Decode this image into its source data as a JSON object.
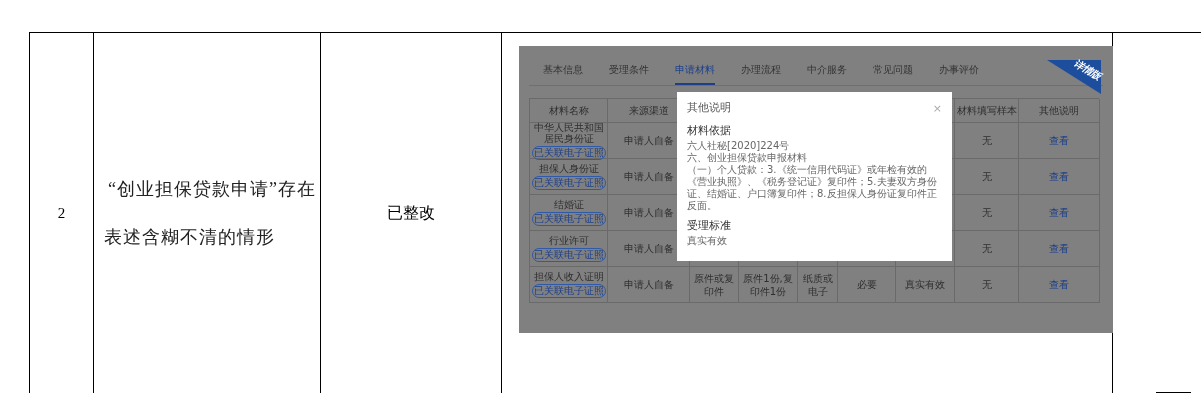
{
  "row": {
    "number": "2",
    "issue": "“创业担保贷款申请”存在表述含糊不清的情形",
    "status": "已整改"
  },
  "screenshot": {
    "tabs": [
      {
        "label": "基本信息",
        "selected": false
      },
      {
        "label": "受理条件",
        "selected": false
      },
      {
        "label": "申请材料",
        "selected": true
      },
      {
        "label": "办理流程",
        "selected": false
      },
      {
        "label": "中介服务",
        "selected": false
      },
      {
        "label": "常见问题",
        "selected": false
      },
      {
        "label": "办事评价",
        "selected": false
      }
    ],
    "ribbon": "详情版",
    "columns_left": [
      "材料名称",
      "来源渠道"
    ],
    "columns_right": [
      "材料填写样本",
      "其他说明"
    ],
    "rows": [
      {
        "name": "中华人民共和国居民身份证",
        "tag": "已关联电子证照",
        "source": "申请人自备",
        "sample": "无",
        "link": "查看"
      },
      {
        "name": "担保人身份证",
        "tag": "已关联电子证照",
        "source": "申请人自备",
        "sample": "无",
        "link": "查看"
      },
      {
        "name": "结婚证",
        "tag": "已关联电子证照",
        "source": "申请人自备",
        "sample": "无",
        "link": "查看"
      },
      {
        "name": "行业许可",
        "tag": "已关联电子证照",
        "source": "申请人自备",
        "sample": "无",
        "link": "查看"
      },
      {
        "name": "担保人收入证明",
        "tag": "已关联电子证照",
        "source": "申请人自备",
        "cells": [
          "原件或复印件",
          "原件1份,复印件1份",
          "纸质或电子",
          "必要",
          "真实有效"
        ],
        "sample": "无",
        "link": "查看"
      }
    ],
    "modal": {
      "title": "其他说明",
      "close": "×",
      "sections": [
        {
          "heading": "材料依据",
          "lines": [
            "六人社秘[2020]224号",
            "六、创业担保贷款申报材料",
            "（一）个人贷款：3.《统一信用代码证》或年检有效的《营业执照》、《税务登记证》复印件；5.夫妻双方身份证、结婚证、户口簿复印件；8.反担保人身份证复印件正反面。"
          ]
        },
        {
          "heading": "受理标准",
          "lines": [
            "真实有效"
          ]
        }
      ]
    }
  }
}
